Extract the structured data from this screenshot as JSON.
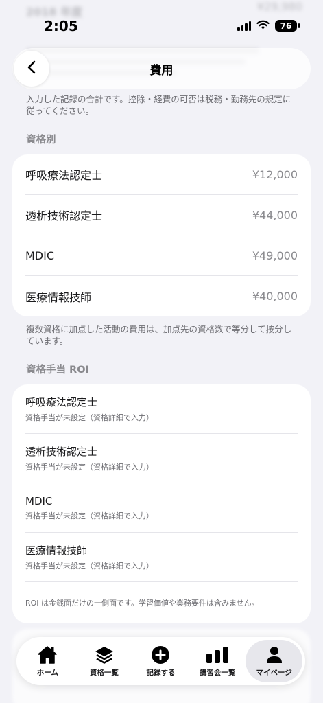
{
  "status_bar": {
    "time": "2:05",
    "battery": "76"
  },
  "background_peek": {
    "top_title": "2018 年度",
    "top_amount": "¥29,980"
  },
  "header": {
    "title": "費用"
  },
  "intro_note": "入力した記録の合計です。控除・経費の可否は税務・勤務先の規定に従ってください。",
  "by_qualification": {
    "header": "資格別",
    "items": [
      {
        "name": "呼吸療法認定士",
        "amount": "¥12,000"
      },
      {
        "name": "透析技術認定士",
        "amount": "¥44,000"
      },
      {
        "name": "MDIC",
        "amount": "¥49,000"
      },
      {
        "name": "医療情報技師",
        "amount": "¥40,000"
      }
    ],
    "note": "複数資格に加点した活動の費用は、加点先の資格数で等分して按分しています。"
  },
  "roi": {
    "header": "資格手当 ROI",
    "items": [
      {
        "name": "呼吸療法認定士",
        "sub": "資格手当が未設定（資格詳細で入力）"
      },
      {
        "name": "透析技術認定士",
        "sub": "資格手当が未設定（資格詳細で入力）"
      },
      {
        "name": "MDIC",
        "sub": "資格手当が未設定（資格詳細で入力）"
      },
      {
        "name": "医療情報技師",
        "sub": "資格手当が未設定（資格詳細で入力）"
      }
    ],
    "footer": "ROI は金銭面だけの一側面です。学習価値や業務要件は含みません。"
  },
  "tabs": [
    {
      "label": "ホーム",
      "icon": "house-icon",
      "active": false
    },
    {
      "label": "資格一覧",
      "icon": "layers-icon",
      "active": false
    },
    {
      "label": "記録する",
      "icon": "plus-circle-icon",
      "active": false
    },
    {
      "label": "講習会一覧",
      "icon": "bar-chart-icon",
      "active": false
    },
    {
      "label": "マイページ",
      "icon": "person-icon",
      "active": true
    }
  ],
  "colors": {
    "background": "#f2f2f7",
    "card": "#ffffff",
    "secondary_text": "#8a8a8e",
    "active_tab": "#e7e7ec"
  }
}
